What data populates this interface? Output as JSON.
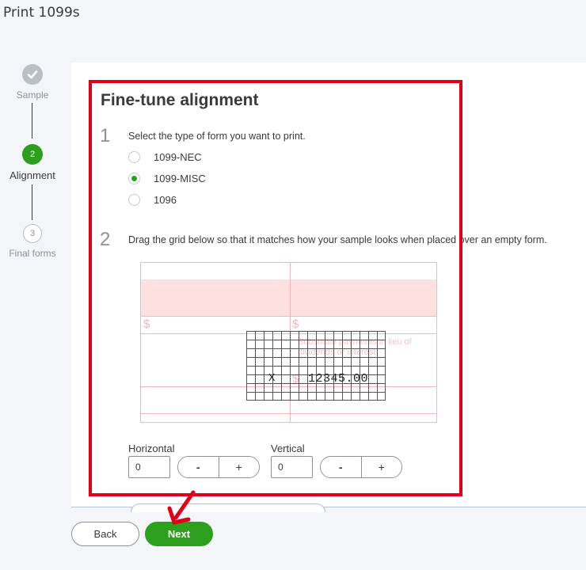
{
  "page": {
    "title": "Print 1099s"
  },
  "stepper": [
    {
      "number": "",
      "label": "Sample",
      "state": "done",
      "icon": "checkmark-icon"
    },
    {
      "number": "2",
      "label": "Alignment",
      "state": "current"
    },
    {
      "number": "3",
      "label": "Final forms",
      "state": "todo"
    }
  ],
  "main": {
    "heading": "Fine-tune alignment",
    "step1": {
      "number": "1",
      "instruction": "Select the type of form you want to print.",
      "options": [
        {
          "label": "1099-NEC",
          "checked": false
        },
        {
          "label": "1099-MISC",
          "checked": true
        },
        {
          "label": "1096",
          "checked": false
        }
      ]
    },
    "step2": {
      "number": "2",
      "instruction": "Drag the grid below so that it matches how your sample looks when placed over an empty form."
    },
    "preview": {
      "dollar_sign": "$",
      "note": "Substitute payments in lieu of dividends or interest",
      "grid_marker": "X",
      "grid_amount": "12345.00"
    },
    "controls": {
      "horizontal_label": "Horizontal",
      "horizontal_value": "0",
      "vertical_label": "Vertical",
      "vertical_value": "0",
      "minus": "-",
      "plus": "+"
    }
  },
  "footer": {
    "back_label": "Back",
    "next_label": "Next"
  },
  "colors": {
    "accent": "#2ca01c",
    "highlight": "#e1001a",
    "form_pink": "#f4b7b7"
  }
}
